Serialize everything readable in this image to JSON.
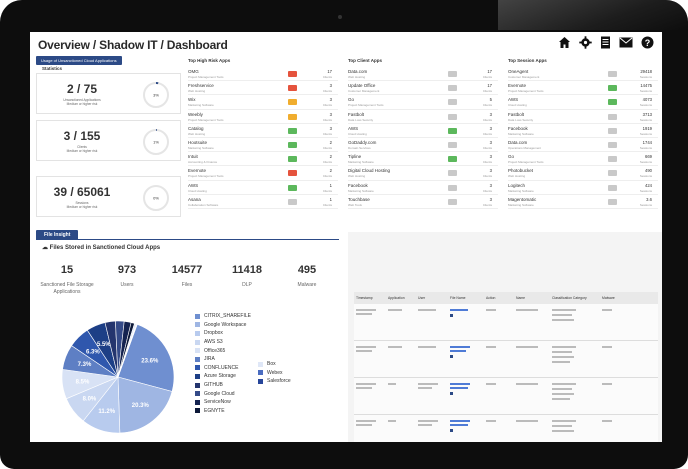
{
  "header": {
    "title": "Overview / Shadow IT / Dashboard",
    "icons": [
      "home-icon",
      "gear-icon",
      "report-icon",
      "mail-icon",
      "help-icon"
    ]
  },
  "usage": {
    "tab": "Usage of Unsanctioned Cloud Applications",
    "statistics_label": "Statistics",
    "stats": [
      {
        "value": "2 / 75",
        "sub1": "Unsanctioned Applications",
        "sub2": "Medium or higher risk",
        "pct": "3%",
        "fraction": 0.03
      },
      {
        "value": "3 / 155",
        "sub1": "Clients",
        "sub2": "Medium or higher risk",
        "pct": "1%",
        "fraction": 0.01
      },
      {
        "value": "39 / 65061",
        "sub1": "Sessions",
        "sub2": "Medium or higher risk",
        "pct": "0%",
        "fraction": 0.0
      }
    ]
  },
  "top_high_risk": {
    "title": "Top High Risk Apps",
    "rows": [
      {
        "name": "OMG",
        "desc": "Project Management Tools",
        "badge": "#e5533d",
        "value": "17",
        "unit": "Clients"
      },
      {
        "name": "Freshservice",
        "desc": "Web Hosting",
        "badge": "#e5533d",
        "value": "3",
        "unit": "Clients"
      },
      {
        "name": "Wix",
        "desc": "Marketing Software",
        "badge": "#f0ad2e",
        "value": "3",
        "unit": "Clients"
      },
      {
        "name": "Weebly",
        "desc": "Project Management Tools",
        "badge": "#f0ad2e",
        "value": "3",
        "unit": "Clients"
      },
      {
        "name": "Catalog",
        "desc": "Web Hosting",
        "badge": "#5cb85c",
        "value": "3",
        "unit": "Clients"
      },
      {
        "name": "Hootsuite",
        "desc": "Marketing Software",
        "badge": "#5cb85c",
        "value": "2",
        "unit": "Clients"
      },
      {
        "name": "Intuit",
        "desc": "Accounting & Finance",
        "badge": "#5cb85c",
        "value": "2",
        "unit": "Clients"
      },
      {
        "name": "Evernote",
        "desc": "Project Management Tools",
        "badge": "#e5533d",
        "value": "2",
        "unit": "Clients"
      },
      {
        "name": "AWS",
        "desc": "Cloud Hosting",
        "badge": "#5cb85c",
        "value": "1",
        "unit": "Clients"
      },
      {
        "name": "Asana",
        "desc": "Collaboration Software",
        "badge": "#c9c9c9",
        "value": "1",
        "unit": "Clients"
      }
    ]
  },
  "top_client": {
    "title": "Top Client Apps",
    "rows": [
      {
        "name": "Data.com",
        "desc": "Web Hosting",
        "badge": "#c9c9c9",
        "value": "17",
        "unit": "Clients"
      },
      {
        "name": "Update Office",
        "desc": "Customer Management",
        "badge": "#c9c9c9",
        "value": "17",
        "unit": "Clients"
      },
      {
        "name": "Go",
        "desc": "Project Management Tools",
        "badge": "#c9c9c9",
        "value": "5",
        "unit": "Clients"
      },
      {
        "name": "Fastbolt",
        "desc": "Data Loss Security",
        "badge": "#c9c9c9",
        "value": "3",
        "unit": "Clients"
      },
      {
        "name": "AWS",
        "desc": "Cloud Hosting",
        "badge": "#5cb85c",
        "value": "3",
        "unit": "Clients"
      },
      {
        "name": "GoDaddy.com",
        "desc": "Domain Services",
        "badge": "#c9c9c9",
        "value": "3",
        "unit": "Clients"
      },
      {
        "name": "Tipline",
        "desc": "Marketing Software",
        "badge": "#5cb85c",
        "value": "3",
        "unit": "Clients"
      },
      {
        "name": "Digital Cloud Hosting",
        "desc": "Web Hosting",
        "badge": "#c9c9c9",
        "value": "3",
        "unit": "Clients"
      },
      {
        "name": "Facebook",
        "desc": "Marketing Software",
        "badge": "#c9c9c9",
        "value": "3",
        "unit": "Clients"
      },
      {
        "name": "Touchbase",
        "desc": "Web Tools",
        "badge": "#c9c9c9",
        "value": "3",
        "unit": "Clients"
      }
    ]
  },
  "top_session": {
    "title": "Top Session Apps",
    "rows": [
      {
        "name": "OneAgent",
        "desc": "Customer Management",
        "badge": "#c9c9c9",
        "value": "29418",
        "unit": "Sessions"
      },
      {
        "name": "Evernote",
        "desc": "Project Management Tools",
        "badge": "#5cb85c",
        "value": "14475",
        "unit": "Sessions"
      },
      {
        "name": "AWS",
        "desc": "Cloud Hosting",
        "badge": "#5cb85c",
        "value": "4073",
        "unit": "Sessions"
      },
      {
        "name": "Fastbolt",
        "desc": "Data Loss Security",
        "badge": "#c9c9c9",
        "value": "3713",
        "unit": "Sessions"
      },
      {
        "name": "Facebook",
        "desc": "Marketing Software",
        "badge": "#c9c9c9",
        "value": "1919",
        "unit": "Sessions"
      },
      {
        "name": "Data.com",
        "desc": "Operations Management",
        "badge": "#c9c9c9",
        "value": "1744",
        "unit": "Sessions"
      },
      {
        "name": "Go",
        "desc": "Project Management Tools",
        "badge": "#c9c9c9",
        "value": "669",
        "unit": "Sessions"
      },
      {
        "name": "Photobucket",
        "desc": "Web Hosting",
        "badge": "#c9c9c9",
        "value": "490",
        "unit": "Sessions"
      },
      {
        "name": "Logitech",
        "desc": "Marketing Software",
        "badge": "#c9c9c9",
        "value": "424",
        "unit": "Sessions"
      },
      {
        "name": "Magentomatic",
        "desc": "Marketing Software",
        "badge": "#c9c9c9",
        "value": "3.6",
        "unit": "Sessions"
      }
    ]
  },
  "file_insight": {
    "tab": "File Insight",
    "heading": "Files Stored in Sanctioned Cloud Apps",
    "stats": [
      {
        "value": "15",
        "label": "Sanctioned File Storage Applications"
      },
      {
        "value": "973",
        "label": "Users"
      },
      {
        "value": "14577",
        "label": "Files"
      },
      {
        "value": "11418",
        "label": "DLP"
      },
      {
        "value": "495",
        "label": "Malware"
      }
    ]
  },
  "chart_data": {
    "type": "pie",
    "series": [
      {
        "name": "CITRIX_SHAREFILE",
        "value": 23.6,
        "color": "#6f8fd0",
        "label": "23.6%"
      },
      {
        "name": "Google Workspace",
        "value": 20.3,
        "color": "#9fb6e3",
        "label": "20.3%"
      },
      {
        "name": "Dropbox",
        "value": 11.2,
        "color": "#b8cbee",
        "label": "11.2%"
      },
      {
        "name": "AWS S3",
        "value": 8.0,
        "color": "#c9d7f1",
        "label": "8.0%"
      },
      {
        "name": "Office365",
        "value": 8.5,
        "color": "#d8e2f5",
        "label": "8.5%"
      },
      {
        "name": "JIRA",
        "value": 7.3,
        "color": "#5e7fc4",
        "label": "7.3%"
      },
      {
        "name": "CONFLUENCE",
        "value": 6.3,
        "color": "#2f57ad",
        "label": "6.3%"
      },
      {
        "name": "Azure Storage",
        "value": 5.5,
        "color": "#1d3f86",
        "label": "5.5%"
      },
      {
        "name": "GITHUB",
        "value": 3.0,
        "color": "#24356e"
      },
      {
        "name": "Google Cloud",
        "value": 2.5,
        "color": "#344a88"
      },
      {
        "name": "ServiceNow",
        "value": 2.0,
        "color": "#142350"
      },
      {
        "name": "EGNYTE",
        "value": 1.0,
        "color": "#0c1838"
      },
      {
        "name": "Box",
        "value": 0.5,
        "color": "#dfe7f7"
      },
      {
        "name": "Webex",
        "value": 0.2,
        "color": "#4a6cc0"
      },
      {
        "name": "Salesforce",
        "value": 0.1,
        "color": "#27469a"
      }
    ]
  },
  "activity": {
    "table_headers": [
      "Timestamp",
      "Application",
      "User",
      "File Name",
      "Action",
      "Name",
      "Classification Category",
      "Malware"
    ]
  }
}
